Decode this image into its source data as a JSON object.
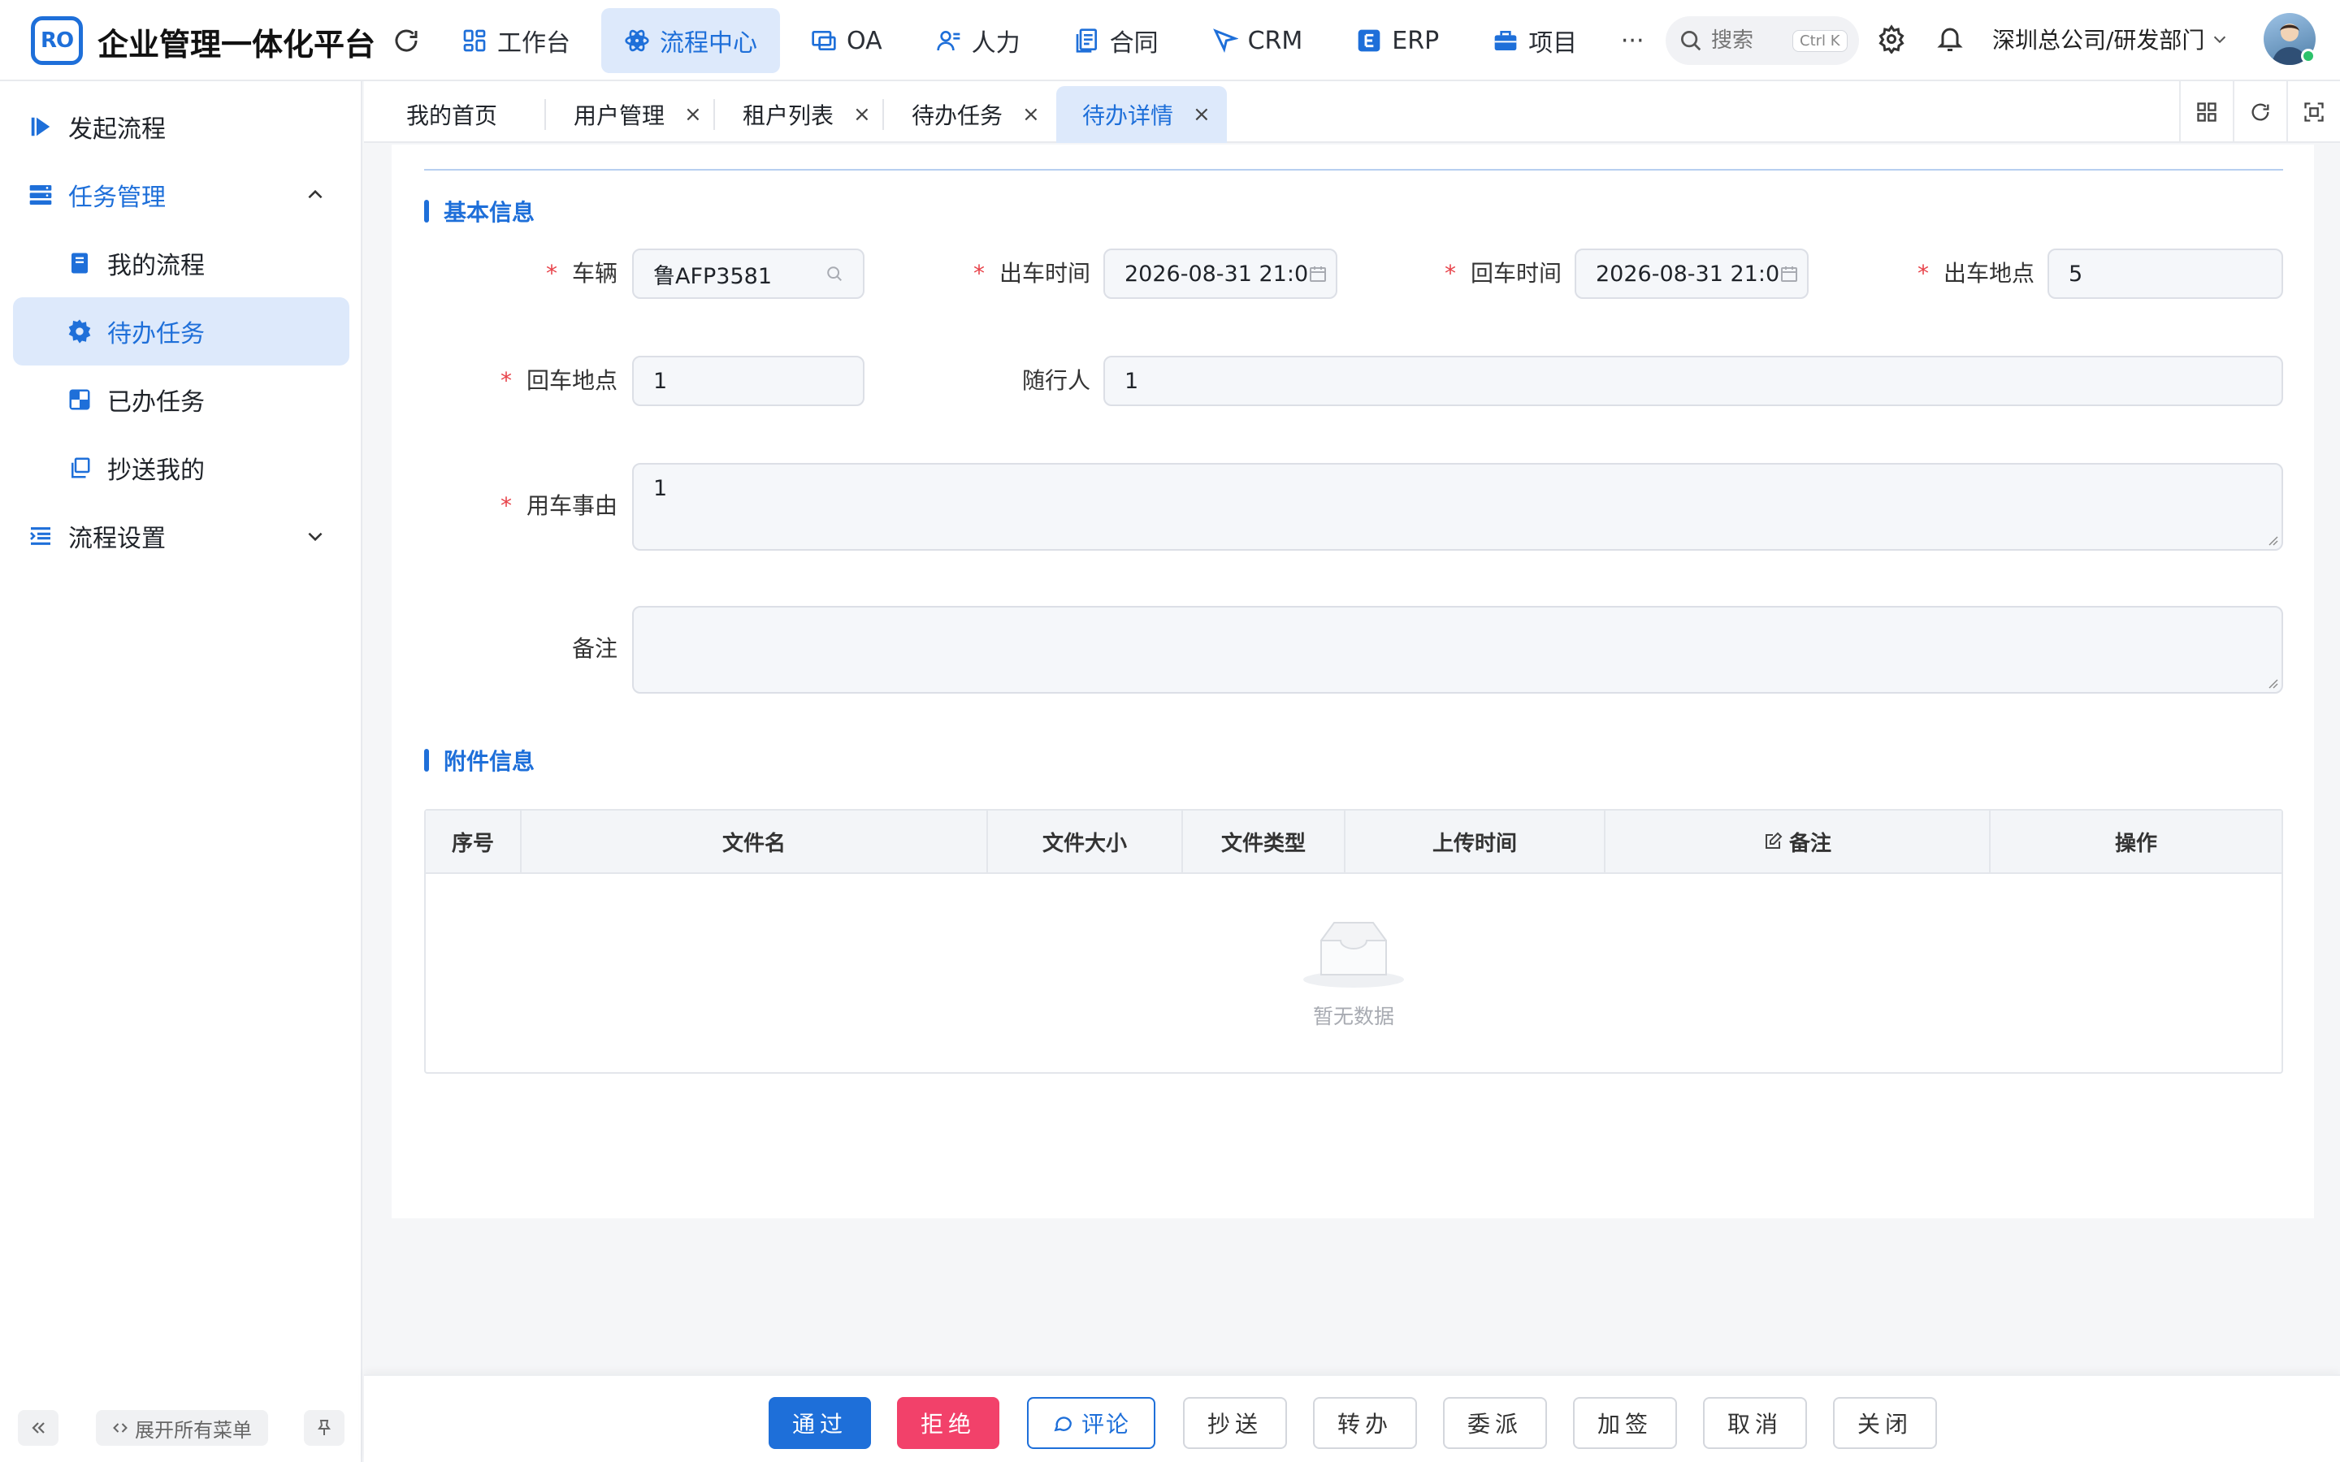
{
  "app": {
    "logo_text": "RO",
    "title": "企业管理一体化平台"
  },
  "topnav": {
    "items": [
      {
        "label": "工作台",
        "icon": "dashboard-icon"
      },
      {
        "label": "流程中心",
        "icon": "workflow-icon",
        "active": true
      },
      {
        "label": "OA",
        "icon": "oa-icon"
      },
      {
        "label": "人力",
        "icon": "people-icon"
      },
      {
        "label": "合同",
        "icon": "contract-icon"
      },
      {
        "label": "CRM",
        "icon": "crm-icon"
      },
      {
        "label": "ERP",
        "icon": "erp-icon"
      },
      {
        "label": "项目",
        "icon": "project-icon"
      }
    ],
    "more": "···"
  },
  "search": {
    "placeholder": "搜索",
    "shortcut": "Ctrl K"
  },
  "org": {
    "label": "深圳总公司/研发部门"
  },
  "sidebar": {
    "items": [
      {
        "label": "发起流程"
      },
      {
        "label": "任务管理"
      },
      {
        "label": "我的流程"
      },
      {
        "label": "待办任务"
      },
      {
        "label": "已办任务"
      },
      {
        "label": "抄送我的"
      },
      {
        "label": "流程设置"
      }
    ],
    "expand_all": "展开所有菜单"
  },
  "tabs": {
    "items": [
      {
        "label": "我的首页"
      },
      {
        "label": "用户管理"
      },
      {
        "label": "租户列表"
      },
      {
        "label": "待办任务"
      },
      {
        "label": "待办详情"
      }
    ],
    "close_symbol": "×"
  },
  "form": {
    "section_basic": "基本信息",
    "vehicle": {
      "label": "车辆",
      "value": "鲁AFP3581"
    },
    "depart_time": {
      "label": "出车时间",
      "value": "2026-08-31 21:0"
    },
    "return_time": {
      "label": "回车时间",
      "value": "2026-08-31 21:0"
    },
    "depart_place": {
      "label": "出车地点",
      "value": "5"
    },
    "return_place": {
      "label": "回车地点",
      "value": "1"
    },
    "companions": {
      "label": "随行人",
      "value": "1"
    },
    "reason": {
      "label": "用车事由",
      "value": "1"
    },
    "remark": {
      "label": "备注",
      "value": ""
    },
    "required_mark": "*"
  },
  "attachments": {
    "section_title": "附件信息",
    "columns": [
      "序号",
      "文件名",
      "文件大小",
      "文件类型",
      "上传时间",
      "备注",
      "操作"
    ],
    "empty_text": "暂无数据"
  },
  "actions": {
    "approve": "通过",
    "reject": "拒绝",
    "comment": "评论",
    "cc": "抄送",
    "transfer": "转办",
    "delegate": "委派",
    "add_sign": "加签",
    "cancel": "取消",
    "close": "关闭"
  },
  "colors": {
    "primary": "#1e6fd9",
    "danger": "#f2416a",
    "required": "#e8434a"
  }
}
